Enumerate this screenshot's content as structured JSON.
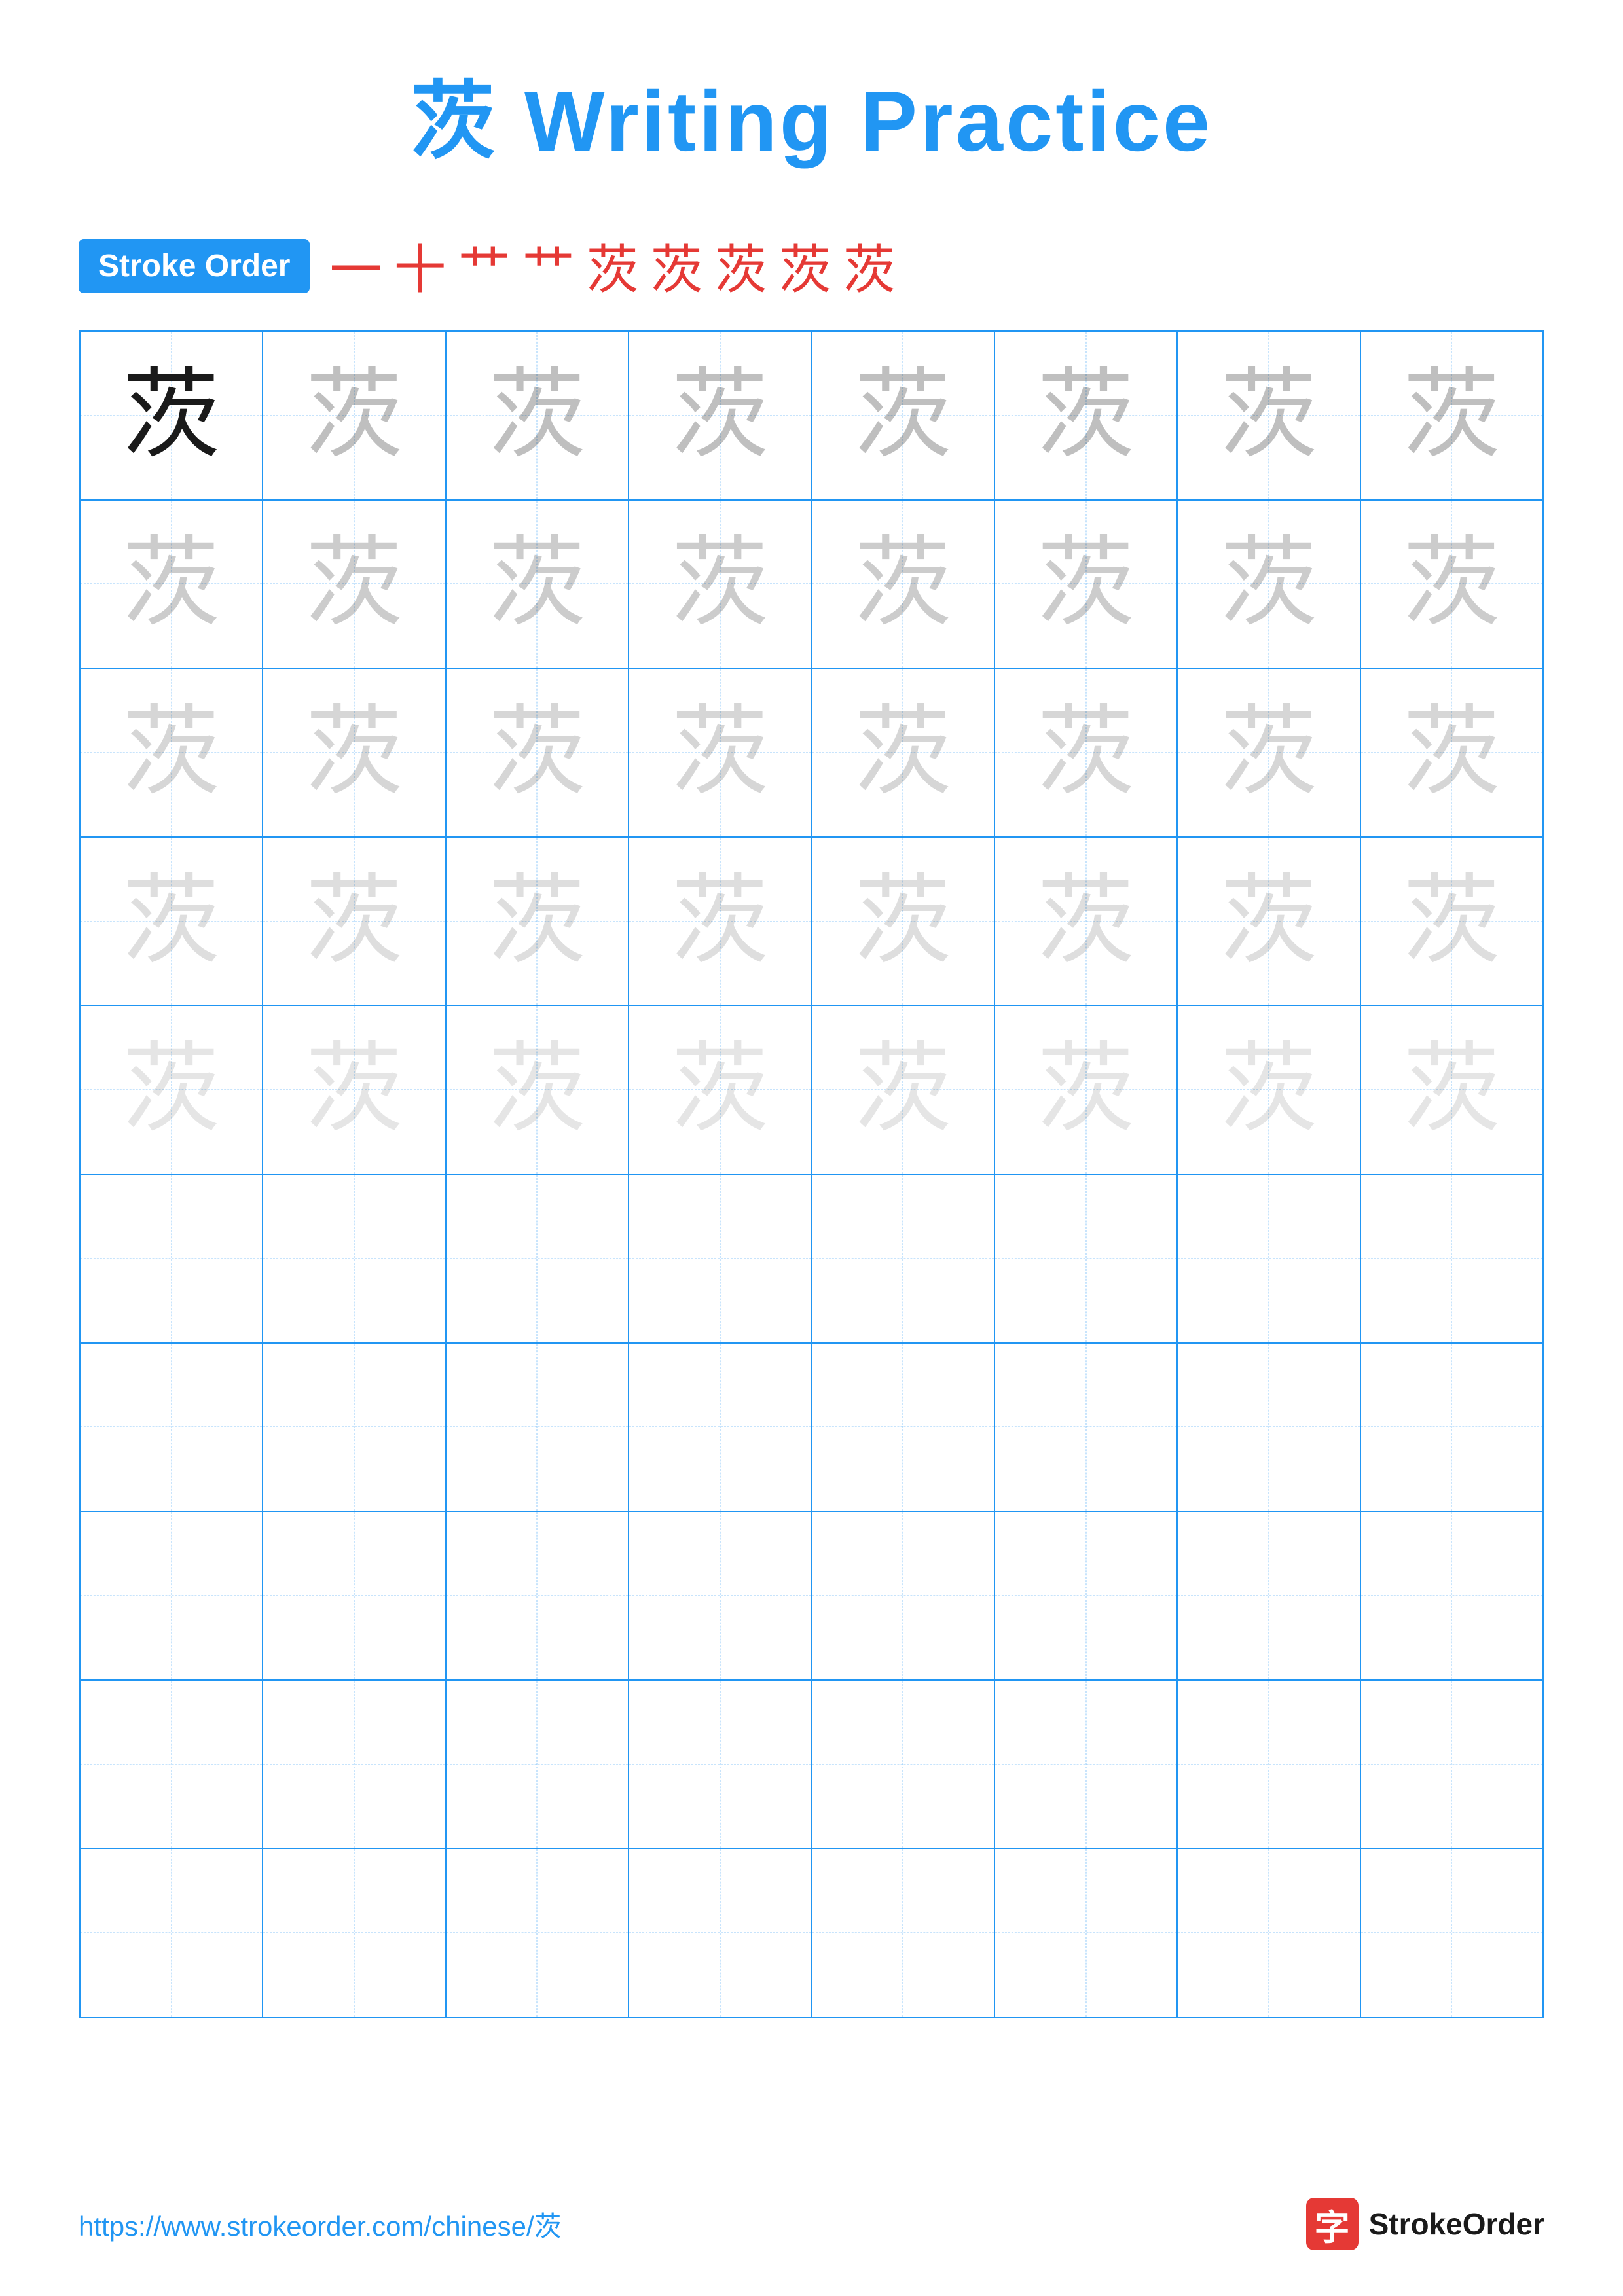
{
  "page": {
    "title": "茨 Writing Practice",
    "stroke_order_label": "Stroke Order",
    "stroke_sequence": [
      "一",
      "十",
      "艹",
      "艹",
      "茨",
      "茨",
      "茨",
      "茨",
      "茨"
    ],
    "character": "茨",
    "footer_url": "https://www.strokeorder.com/chinese/茨",
    "footer_brand": "StrokeOrder",
    "brand_char": "字",
    "grid": {
      "cols": 8,
      "rows": 10
    }
  }
}
